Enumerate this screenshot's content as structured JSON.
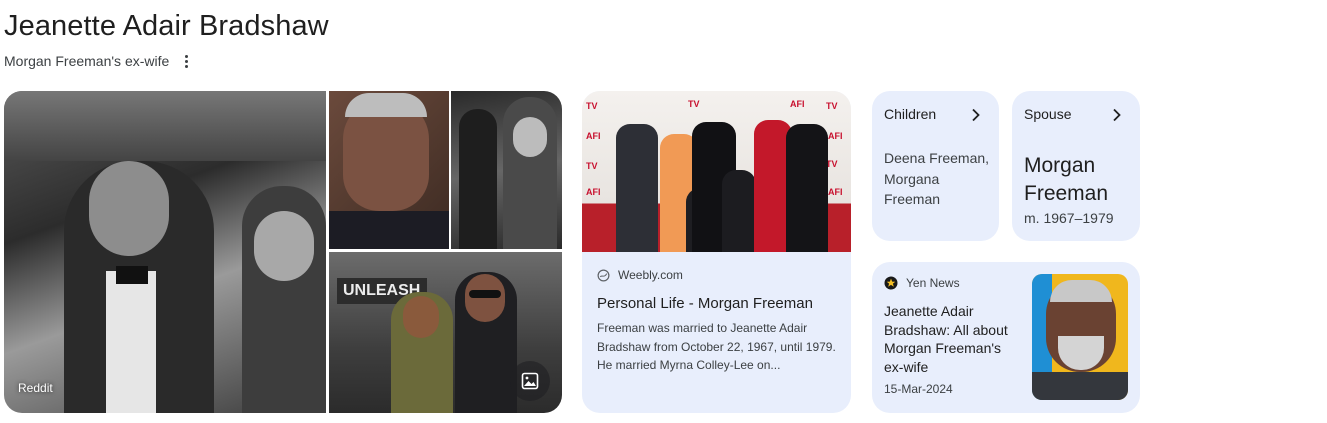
{
  "header": {
    "title": "Jeanette Adair Bradshaw",
    "subtitle": "Morgan Freeman's ex-wife"
  },
  "images": {
    "source_label": "Reddit",
    "street_sign_text": "UNLEASH"
  },
  "article": {
    "source": "Weebly.com",
    "title": "Personal Life - Morgan Freeman",
    "snippet": "Freeman was married to Jeanette Adair Bradshaw from October 22, 1967, until 1979. He married Myrna Colley-Lee on..."
  },
  "children_card": {
    "heading": "Children",
    "value": "Deena Freeman, Morgana Freeman"
  },
  "spouse_card": {
    "heading": "Spouse",
    "name": "Morgan Freeman",
    "detail": "m. 1967–1979"
  },
  "news_card": {
    "source": "Yen News",
    "title": "Jeanette Adair Bradshaw: All about Morgan Freeman's ex-wife",
    "date": "15-Mar-2024"
  },
  "colors": {
    "card_bg": "#e8eefc",
    "text_primary": "#1f1f1f",
    "text_secondary": "#3c4043"
  },
  "icons": [
    "more-vert-icon",
    "image-icon",
    "globe-icon",
    "chevron-right-icon",
    "yen-news-icon"
  ]
}
